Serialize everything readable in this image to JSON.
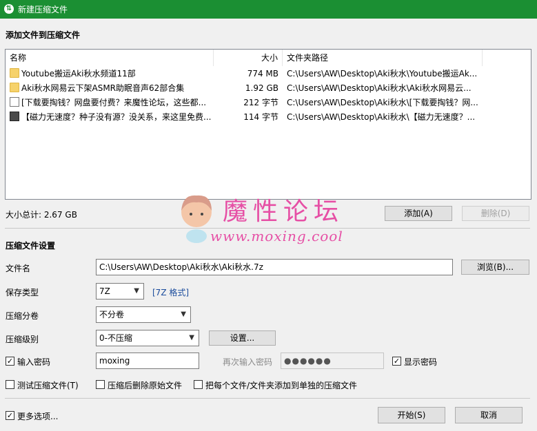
{
  "window": {
    "title": "新建压缩文件"
  },
  "add_section": {
    "title": "添加文件到压缩文件"
  },
  "file_list": {
    "headers": {
      "name": "名称",
      "size": "大小",
      "path": "文件夹路径"
    },
    "rows": [
      {
        "icon": "folder-icon",
        "name": "Youtube搬运Aki秋水频道11部",
        "size": "774 MB",
        "path": "C:\\Users\\AW\\Desktop\\Aki秋水\\Youtube搬运Ak..."
      },
      {
        "icon": "folder-icon",
        "name": "Aki秋水网易云下架ASMR助眠音声62部合集",
        "size": "1.92 GB",
        "path": "C:\\Users\\AW\\Desktop\\Aki秋水\\Aki秋水网易云..."
      },
      {
        "icon": "document-icon",
        "name": "[下载要掏钱？网盘要付费？来魔性论坛，这些都...",
        "size": "212 字节",
        "path": "C:\\Users\\AW\\Desktop\\Aki秋水\\[下载要掏钱？网..."
      },
      {
        "icon": "shortcut-icon",
        "name": "【磁力无速度？种子没有源？没关系，来这里免费...",
        "size": "114 字节",
        "path": "C:\\Users\\AW\\Desktop\\Aki秋水\\【磁力无速度？..."
      }
    ]
  },
  "total_size": "大小总计: 2.67 GB",
  "buttons": {
    "add": "添加(A)",
    "remove": "删除(D)",
    "browse": "浏览(B)...",
    "settings": "设置...",
    "start": "开始(S)",
    "cancel": "取消"
  },
  "watermark": {
    "title": "魔性论坛",
    "url": "www.moxing.cool"
  },
  "settings_section": {
    "title": "压缩文件设置",
    "filename_label": "文件名",
    "filename_value": "C:\\Users\\AW\\Desktop\\Aki秋水\\Aki秋水.7z",
    "save_type_label": "保存类型",
    "save_type_value": "7Z",
    "format_link": "[7Z 格式]",
    "split_label": "压缩分卷",
    "split_value": "不分卷",
    "level_label": "压缩级别",
    "level_value": "0-不压缩",
    "password_label": "输入密码",
    "password_value": "moxing",
    "reenter_label": "再次输入密码",
    "reenter_value": "●●●●●●",
    "show_password_label": "显示密码"
  },
  "options": {
    "test": "测试压缩文件(T)",
    "delete_after": "压缩后删除原始文件",
    "each_separate": "把每个文件/文件夹添加到单独的压缩文件",
    "more_options": "更多选项..."
  },
  "checkbox_states": {
    "password": true,
    "show_password": true,
    "test": false,
    "delete_after": false,
    "each_separate": false,
    "more_options": true
  }
}
